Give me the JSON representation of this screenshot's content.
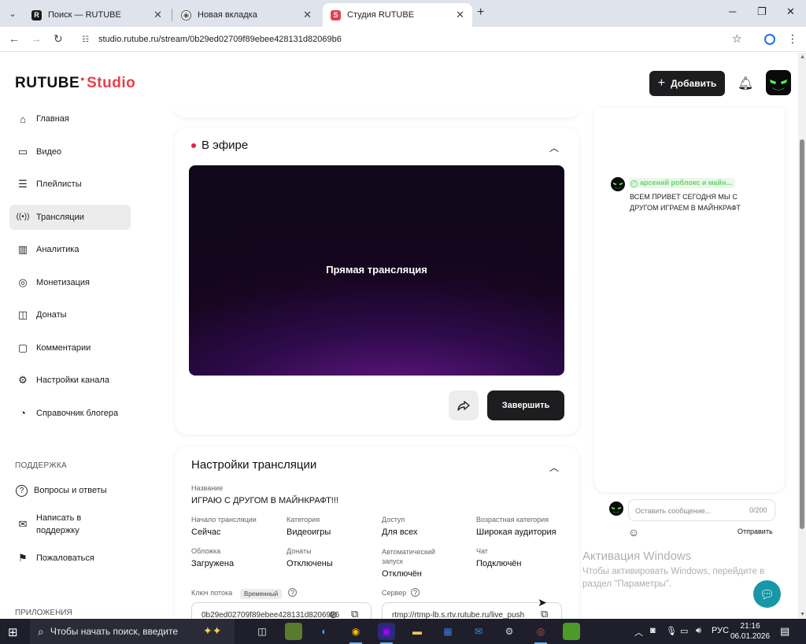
{
  "browser": {
    "tabs": [
      {
        "title": "Поиск — RUTUBE",
        "favicon": "rutube-icon",
        "active": false
      },
      {
        "title": "Новая вкладка",
        "favicon": "chrome-icon",
        "active": false
      },
      {
        "title": "Студия RUTUBE",
        "favicon": "studio-icon",
        "active": true
      }
    ],
    "url": "studio.rutube.ru/stream/0b29ed02709f89ebee428131d82069b6",
    "window_controls": {
      "minimize": "─",
      "maximize": "❐",
      "close": "✕"
    }
  },
  "header": {
    "logo_brand": "RUTUBE",
    "logo_studio": "Studio",
    "add_button": "Добавить"
  },
  "sidebar": {
    "items": [
      {
        "label": "Главная",
        "icon": "home-icon",
        "glyph": "⌂"
      },
      {
        "label": "Видео",
        "icon": "video-icon",
        "glyph": "▭"
      },
      {
        "label": "Плейлисты",
        "icon": "playlist-icon",
        "glyph": "☰"
      },
      {
        "label": "Трансляции",
        "icon": "broadcast-icon",
        "glyph": "((•))"
      },
      {
        "label": "Аналитика",
        "icon": "analytics-icon",
        "glyph": "▥"
      },
      {
        "label": "Монетизация",
        "icon": "monetization-icon",
        "glyph": "◎"
      },
      {
        "label": "Донаты",
        "icon": "donate-icon",
        "glyph": "◫"
      },
      {
        "label": "Комментарии",
        "icon": "comments-icon",
        "glyph": "▢"
      },
      {
        "label": "Настройки канала",
        "icon": "settings-icon",
        "glyph": "⚙"
      },
      {
        "label": "Справочник блогера",
        "icon": "guide-icon",
        "glyph": "◔"
      }
    ],
    "active_index": 3,
    "support_title": "ПОДДЕРЖКА",
    "support_items": [
      {
        "label": "Вопросы и ответы",
        "icon": "faq-icon",
        "glyph": "?"
      },
      {
        "label": "Написать в поддержку",
        "icon": "mail-icon",
        "glyph": "✉"
      },
      {
        "label": "Пожаловаться",
        "icon": "flag-icon",
        "glyph": "⚑"
      }
    ],
    "apps_title": "ПРИЛОЖЕНИЯ"
  },
  "live": {
    "title": "В эфире",
    "player_label": "Прямая трансляция",
    "finish_button": "Завершить"
  },
  "settings": {
    "title": "Настройки трансляции",
    "name_label": "Название",
    "name_value": "ИГРАЮ С ДРУГОМ В МАЙНКРАФТ!!!",
    "fields": [
      {
        "label": "Начало трансляции",
        "value": "Сейчас"
      },
      {
        "label": "Категория",
        "value": "Видеоигры"
      },
      {
        "label": "Доступ",
        "value": "Для всех"
      },
      {
        "label": "Возрастная категория",
        "value": "Широкая аудитория"
      },
      {
        "label": "Обложка",
        "value": "Загружена"
      },
      {
        "label": "Донаты",
        "value": "Отключены"
      },
      {
        "label": "Автоматический запуск",
        "value": "Отключён"
      },
      {
        "label": "Чат",
        "value": "Подключён"
      }
    ],
    "stream_key_label": "Ключ потока",
    "stream_key_badge": "Временный",
    "stream_key_value": "0b29ed02709f89ebee428131d82069b6",
    "server_label": "Сервер",
    "server_value": "rtmp://rtmp-lb.s.rtv.rutube.ru/live_push"
  },
  "chat": {
    "author": "арсений роблокс и майн...",
    "message": "ВСЕМ ПРИВЕТ СЕГОДНЯ МЫ С ДРУГОМ ИГРАЕМ В МАЙНКРАФТ",
    "input_placeholder": "Оставить сообщение...",
    "counter": "0/200",
    "send_button": "Отправить"
  },
  "watermark": {
    "line1": "Активация Windows",
    "line2": "Чтобы активировать Windows, перейдите в раздел \"Параметры\"."
  },
  "taskbar": {
    "search_placeholder": "Чтобы начать поиск, введите",
    "language": "РУС",
    "time": "21:16",
    "date": "06.01.2026"
  },
  "colors": {
    "accent_red": "#e8404a",
    "live_dot": "#e0204a",
    "chat_author_green": "#6cd26e",
    "help_fab": "#1897a8"
  }
}
